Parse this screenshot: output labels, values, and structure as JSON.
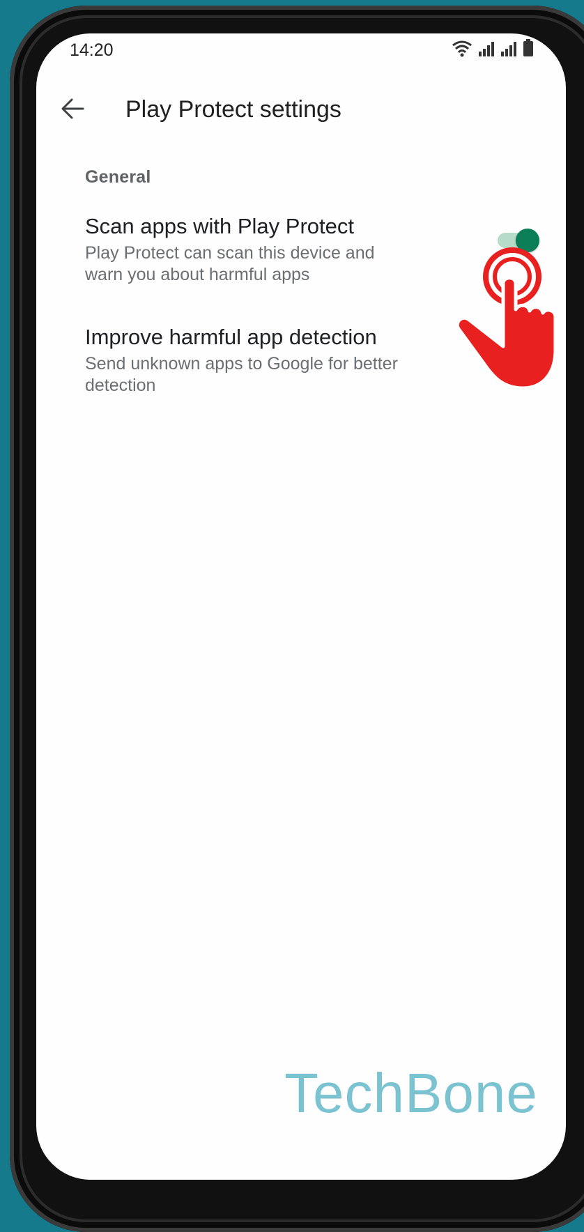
{
  "status_bar": {
    "time": "14:20",
    "icons": [
      "wifi-icon",
      "signal-icon",
      "signal-icon",
      "battery-icon"
    ]
  },
  "app_bar": {
    "back_icon": "arrow-left-icon",
    "title": "Play Protect settings"
  },
  "section": {
    "header": "General"
  },
  "settings": [
    {
      "title": "Scan apps with Play Protect",
      "description": "Play Protect can scan this device and warn you about harmful apps",
      "enabled": true
    },
    {
      "title": "Improve harmful app detection",
      "description": "Send unknown apps to Google for better detection",
      "enabled": true
    }
  ],
  "overlay": {
    "pointer_icon": "tap-hand-icon"
  },
  "watermark": "TechBone",
  "colors": {
    "background": "#147a8c",
    "switch_on": "#0a7e57",
    "switch_track": "#b6dcc9",
    "hand": "#e8201f",
    "watermark": "#7cc3d1"
  }
}
